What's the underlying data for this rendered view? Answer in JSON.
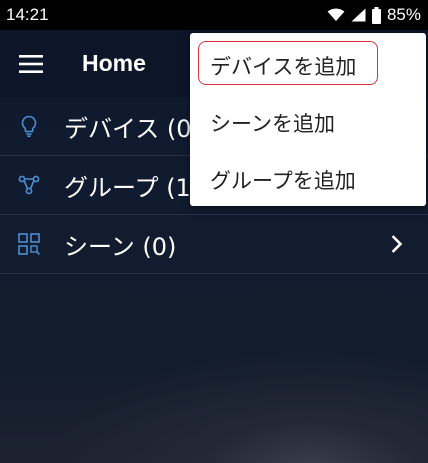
{
  "status_bar": {
    "time": "14:21",
    "battery": "85%",
    "icons": [
      "wifi-icon",
      "signal-icon",
      "battery-icon"
    ]
  },
  "app_bar": {
    "title": "Home",
    "menu_icon": "hamburger-menu-icon"
  },
  "list": {
    "items": [
      {
        "label": "デバイス (0",
        "icon": "lightbulb-icon"
      },
      {
        "label": "グループ (1",
        "icon": "group-icon"
      },
      {
        "label": "シーン (0)",
        "icon": "scene-icon"
      }
    ]
  },
  "popup_menu": {
    "items": [
      {
        "label": "デバイスを追加"
      },
      {
        "label": "シーンを追加"
      },
      {
        "label": "グループを追加"
      }
    ],
    "highlight_color": "#d9343b"
  },
  "colors": {
    "accent_blue": "#4a8fd6",
    "appbar": "#0c1628"
  }
}
